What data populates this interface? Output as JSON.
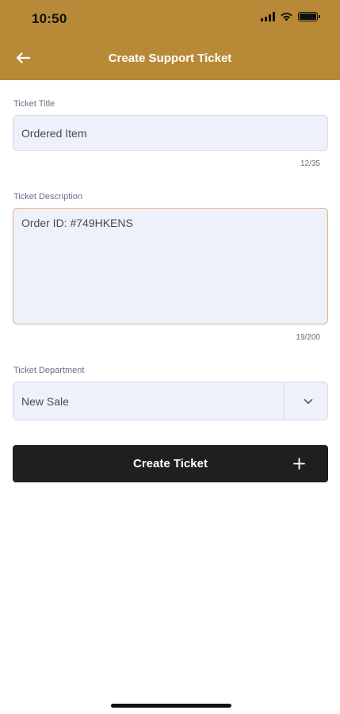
{
  "status_bar": {
    "time": "10:50"
  },
  "nav": {
    "title": "Create Support Ticket",
    "back_icon": "arrow-left-icon"
  },
  "form": {
    "title_field": {
      "label": "Ticket Title",
      "value": "Ordered Item",
      "counter": "12/35"
    },
    "description_field": {
      "label": "Ticket Description",
      "value": "Order ID: #749HKENS",
      "counter": "19/200"
    },
    "department_field": {
      "label": "Ticket Department",
      "value": "New Sale",
      "icon": "chevron-down-icon"
    },
    "submit": {
      "label": "Create Ticket",
      "icon": "plus-icon"
    }
  },
  "colors": {
    "header": "#b88a37",
    "button": "#1f1f1f",
    "focus_border": "#e2b47a",
    "field_bg": "#eef1fb"
  }
}
